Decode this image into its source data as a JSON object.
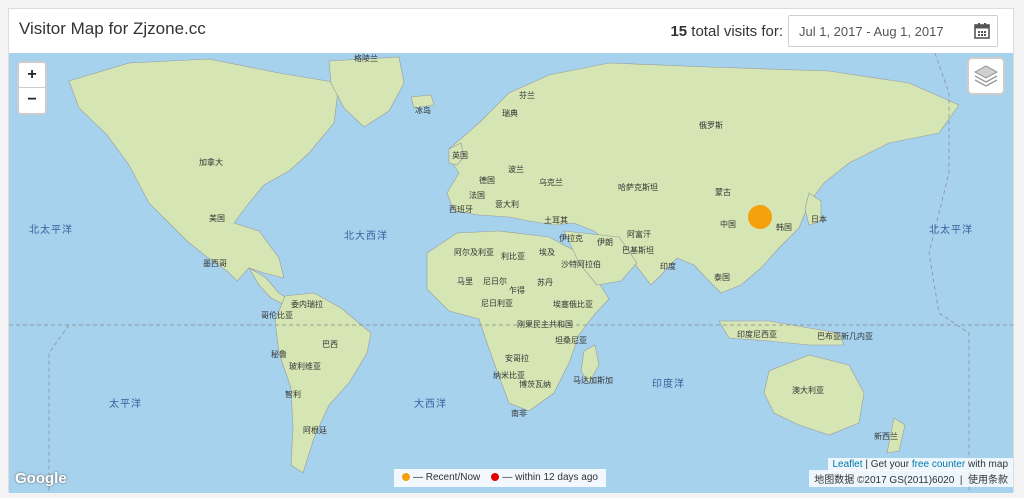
{
  "header": {
    "title": "Visitor Map for Zjzone.cc",
    "visits_count": "15",
    "visits_label": "total visits for:",
    "date_range": "Jul 1, 2017 - Aug 1, 2017"
  },
  "controls": {
    "zoom_in": "+",
    "zoom_out": "−"
  },
  "oceans": {
    "north_pacific_left": "北太平洋",
    "north_pacific_right": "北太平洋",
    "north_atlantic": "北大西洋",
    "pacific": "太平洋",
    "atlantic": "大西洋",
    "indian": "印度洋"
  },
  "countries": {
    "greenland": "格陵兰",
    "iceland": "冰岛",
    "sweden": "瑞典",
    "finland": "芬兰",
    "russia": "俄罗斯",
    "canada": "加拿大",
    "usa": "美国",
    "mexico": "墨西哥",
    "uk": "英国",
    "poland": "波兰",
    "ukraine": "乌克兰",
    "germany": "德国",
    "france": "法国",
    "italy": "意大利",
    "spain": "西班牙",
    "kazakhstan": "哈萨克斯坦",
    "mongolia": "蒙古",
    "china": "中国",
    "korea": "韩国",
    "japan": "日本",
    "turkey": "土耳其",
    "iraq": "伊拉克",
    "iran": "伊朗",
    "afghanistan": "阿富汗",
    "pakistan": "巴基斯坦",
    "india": "印度",
    "thailand": "泰国",
    "saudi": "沙特阿拉伯",
    "algeria": "阿尔及利亚",
    "libya": "利比亚",
    "egypt": "埃及",
    "mali": "马里",
    "niger": "尼日尔",
    "chad": "乍得",
    "sudan": "苏丹",
    "nigeria": "尼日利亚",
    "ethiopia": "埃塞俄比亚",
    "drc": "刚果民主共和国",
    "tanzania": "坦桑尼亚",
    "angola": "安哥拉",
    "namibia": "纳米比亚",
    "botswana": "博茨瓦纳",
    "madagascar": "马达加斯加",
    "south_africa": "南非",
    "venezuela": "委内瑞拉",
    "colombia": "哥伦比亚",
    "brazil": "巴西",
    "peru": "秘鲁",
    "bolivia": "玻利维亚",
    "chile": "智利",
    "argentina": "阿根廷",
    "indonesia": "印度尼西亚",
    "png": "巴布亚新几内亚",
    "australia": "澳大利亚",
    "new_zealand": "新西兰"
  },
  "legend": {
    "recent_label": "— Recent/Now",
    "within_label": "— within 12 days ago",
    "recent_color": "#f5a00d",
    "within_color": "#e60000"
  },
  "attribution": {
    "leaflet": "Leaflet",
    "sep": "| Get your",
    "free_counter": "free counter",
    "with_map": "with map",
    "copyright": "地图数据 ©2017 GS(2011)6020",
    "terms": "使用条款"
  },
  "branding": {
    "google": "Google"
  }
}
